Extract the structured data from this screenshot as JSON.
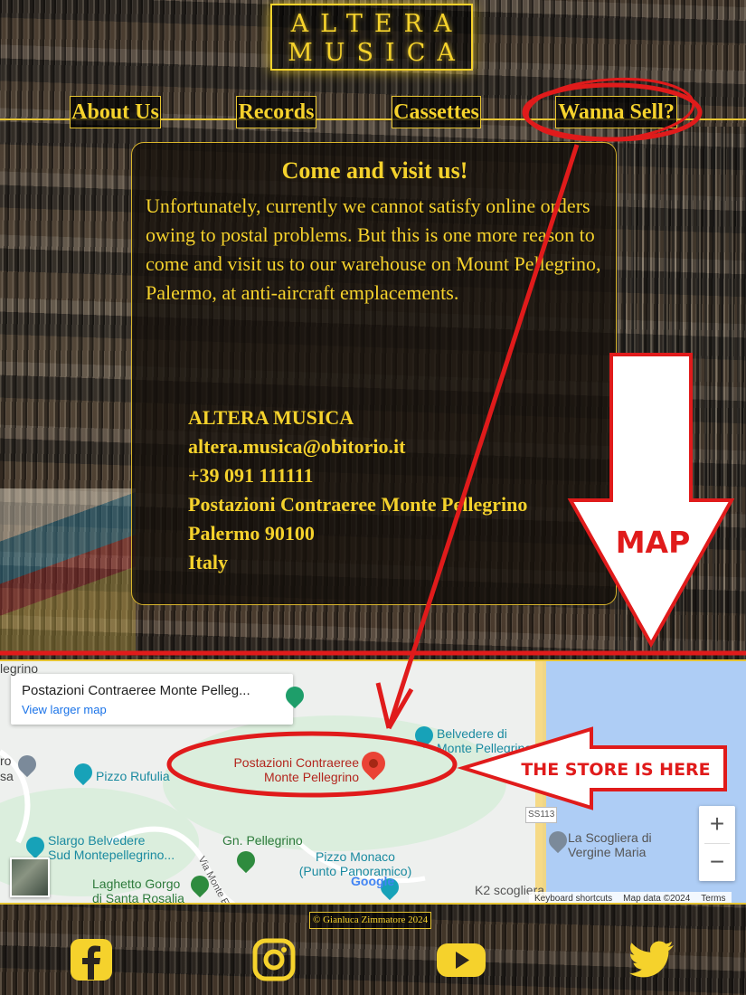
{
  "logo": {
    "line1": "ALTERA",
    "line2": "MUSICA"
  },
  "nav": [
    {
      "label": "About Us"
    },
    {
      "label": "Records"
    },
    {
      "label": "Cassettes"
    },
    {
      "label": "Wanna Sell?"
    }
  ],
  "visit": {
    "title": "Come and visit us!",
    "text": "Unfortunately, currently we cannot satisfy online orders owing to postal problems. But this is one more reason to come and visit us to our warehouse on Mount Pellegrino, Palermo, at anti-aircraft emplacements."
  },
  "contact": {
    "name": "ALTERA MUSICA",
    "email": "altera.musica@obitorio.it",
    "phone": "+39 091 111111",
    "address": "Postazioni Contraeree Monte Pellegrino",
    "city": "Palermo 90100",
    "country": "Italy"
  },
  "map": {
    "card_title": "Postazioni Contraeree Monte Pelleg...",
    "card_link": "View larger map",
    "pin_label_1": "Postazioni Contraeree",
    "pin_label_2": "Monte Pellegrino",
    "poi": {
      "belvedere": "Belvedere di",
      "belvedere2": "Monte Pellegrino",
      "rufulia": "Pizzo Rufulia",
      "slargo1": "Slargo Belvedere",
      "slargo2": "Sud Montepellegrino...",
      "gn": "Gn. Pellegrino",
      "monaco1": "Pizzo Monaco",
      "monaco2": "(Punto Panoramico)",
      "laghetto1": "Laghetto Gorgo",
      "laghetto2": "di Santa Rosalia",
      "scogliera1": "La Scogliera di",
      "scogliera2": "Vergine Maria",
      "k2": "K2 scogliera",
      "road_ss": "SS113",
      "via": "Via Monte E",
      "edge_top": "legrino",
      "edge_ro": "ro",
      "edge_sa": "sa",
      "google": "Google"
    },
    "zoom_in": "+",
    "zoom_out": "−",
    "footer": {
      "shortcuts": "Keyboard shortcuts",
      "data": "Map data ©2024",
      "terms": "Terms"
    }
  },
  "annotations": {
    "map_label": "MAP",
    "store_label": "THE STORE IS HERE"
  },
  "footer": {
    "copyright": "© Gianluca Zimmatore 2024",
    "social": [
      "facebook-icon",
      "instagram-icon",
      "youtube-icon",
      "twitter-icon"
    ]
  },
  "colors": {
    "gold": "#f5d22c",
    "annotation_red": "#e01b1b",
    "pin_red": "#ea4335"
  }
}
